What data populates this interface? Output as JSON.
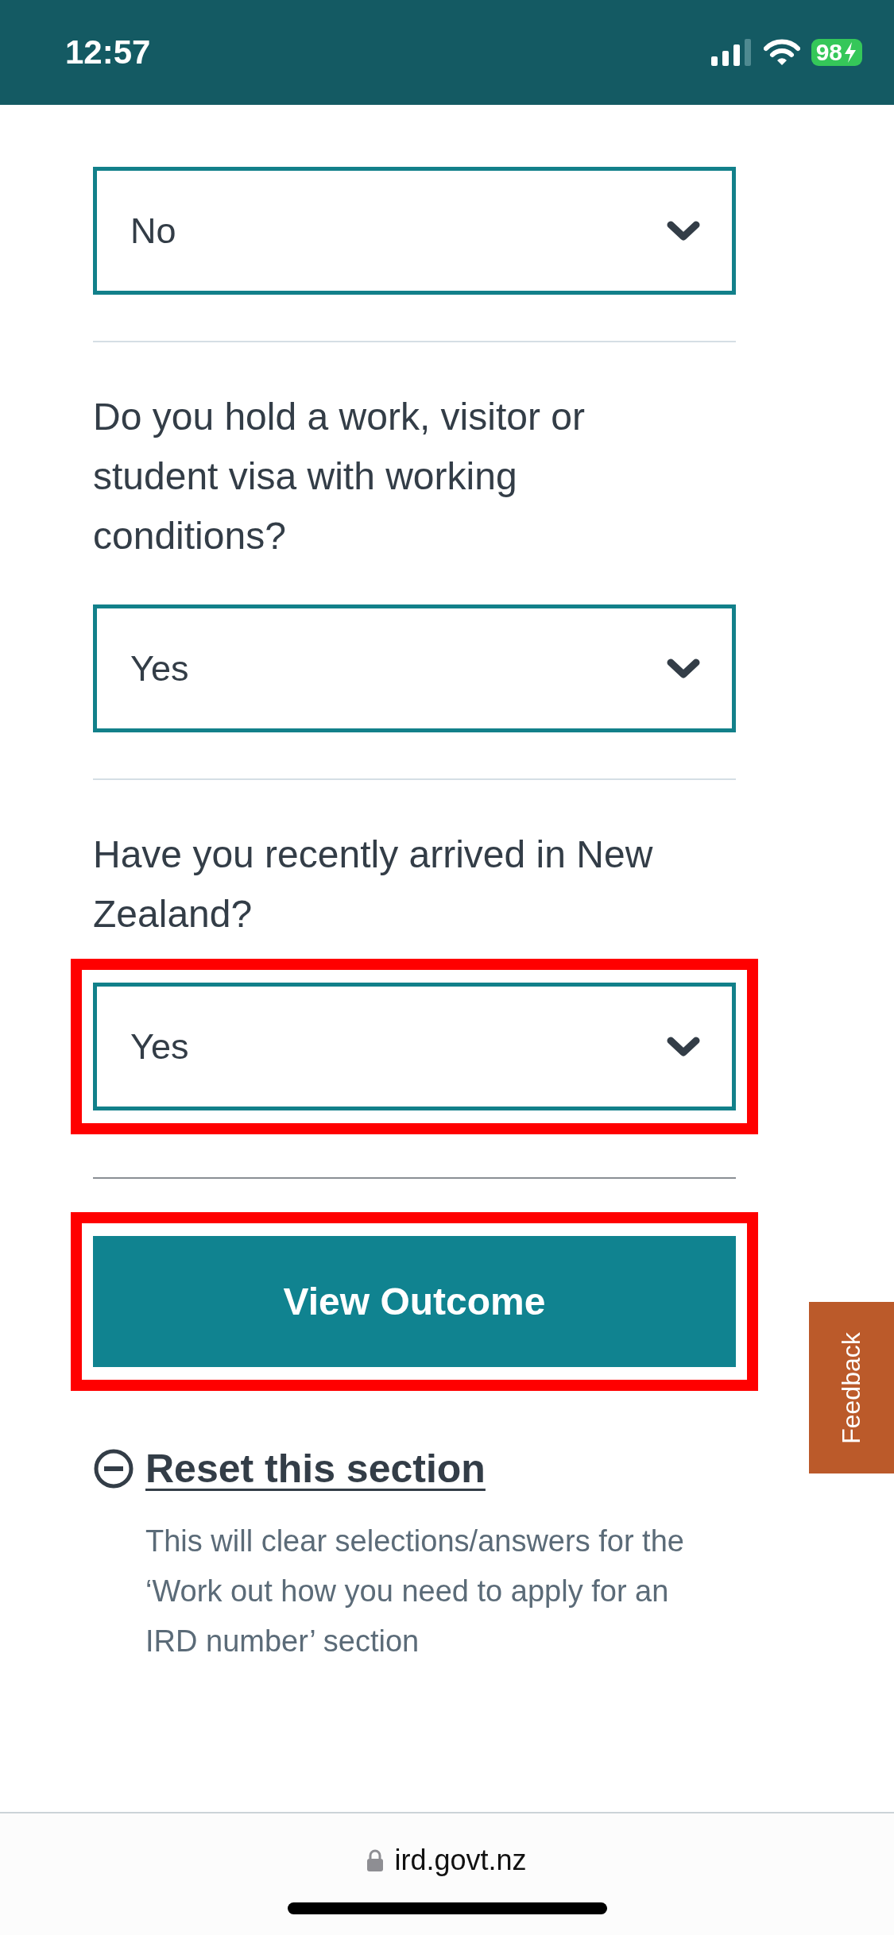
{
  "status_bar": {
    "time": "12:57",
    "battery": "98"
  },
  "questions": [
    {
      "answer": "No",
      "highlighted": false
    },
    {
      "question": "Do you hold a work, visitor or student visa with working conditions?",
      "answer": "Yes",
      "highlighted": false
    },
    {
      "question": "Have you recently arrived in New Zealand?",
      "answer": "Yes",
      "highlighted": true
    }
  ],
  "view_button": {
    "label": "View Outcome",
    "highlighted": true
  },
  "reset": {
    "label": "Reset this section",
    "description": "This will clear selections/answers for the ‘Work out how you need to apply for an IRD number’ section"
  },
  "feedback_tab": {
    "label": "Feedback"
  },
  "browser_bar": {
    "url": "ird.govt.nz"
  }
}
